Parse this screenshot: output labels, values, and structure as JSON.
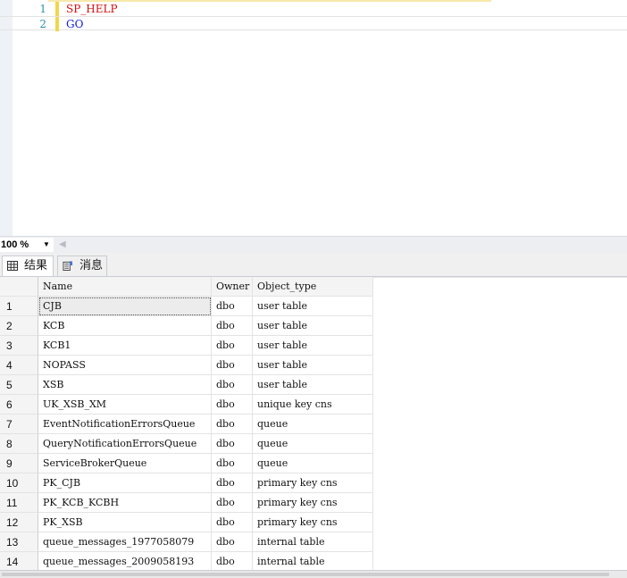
{
  "editor": {
    "lines": [
      {
        "num": "1",
        "text": "SP_HELP",
        "color": "#d01010"
      },
      {
        "num": "2",
        "text": "GO",
        "color": "#1020d8"
      }
    ]
  },
  "zoom": {
    "value": "100 %",
    "arrow": "▼",
    "scroll_left": "◀"
  },
  "tabs": {
    "results": {
      "label": "结果",
      "icon": "grid-icon"
    },
    "messages": {
      "label": "消息",
      "icon": "message-icon"
    }
  },
  "results": {
    "columns": [
      "Name",
      "Owner",
      "Object_type"
    ],
    "rows": [
      {
        "n": "1",
        "name": "CJB",
        "owner": "dbo",
        "type": "user table"
      },
      {
        "n": "2",
        "name": "KCB",
        "owner": "dbo",
        "type": "user table"
      },
      {
        "n": "3",
        "name": "KCB1",
        "owner": "dbo",
        "type": "user table"
      },
      {
        "n": "4",
        "name": "NOPASS",
        "owner": "dbo",
        "type": "user table"
      },
      {
        "n": "5",
        "name": "XSB",
        "owner": "dbo",
        "type": "user table"
      },
      {
        "n": "6",
        "name": "UK_XSB_XM",
        "owner": "dbo",
        "type": "unique key cns"
      },
      {
        "n": "7",
        "name": "EventNotificationErrorsQueue",
        "owner": "dbo",
        "type": "queue"
      },
      {
        "n": "8",
        "name": "QueryNotificationErrorsQueue",
        "owner": "dbo",
        "type": "queue"
      },
      {
        "n": "9",
        "name": "ServiceBrokerQueue",
        "owner": "dbo",
        "type": "queue"
      },
      {
        "n": "10",
        "name": "PK_CJB",
        "owner": "dbo",
        "type": "primary key cns"
      },
      {
        "n": "11",
        "name": "PK_KCB_KCBH",
        "owner": "dbo",
        "type": "primary key cns"
      },
      {
        "n": "12",
        "name": "PK_XSB",
        "owner": "dbo",
        "type": "primary key cns"
      },
      {
        "n": "13",
        "name": "queue_messages_1977058079",
        "owner": "dbo",
        "type": "internal table"
      },
      {
        "n": "14",
        "name": "queue_messages_2009058193",
        "owner": "dbo",
        "type": "internal table"
      }
    ]
  }
}
